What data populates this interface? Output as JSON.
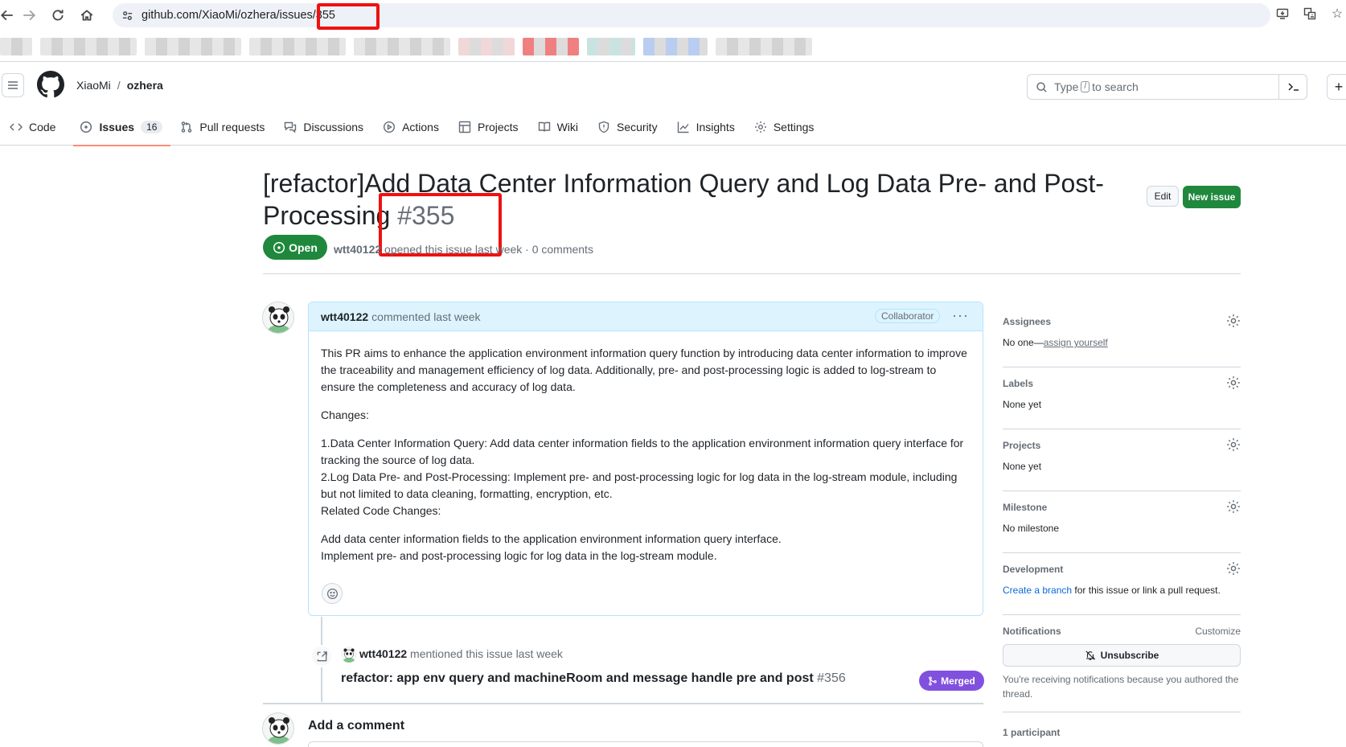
{
  "browser": {
    "url": "github.com/XiaoMi/ozhera/issues/355"
  },
  "header": {
    "owner": "XiaoMi",
    "separator": "/",
    "repo": "ozhera",
    "search_prefix": "Type",
    "search_key": "/",
    "search_suffix": "to search"
  },
  "repo_nav": {
    "tabs": [
      {
        "label": "Code",
        "icon": "code-icon"
      },
      {
        "label": "Issues",
        "icon": "issue-opened-icon",
        "count": "16",
        "selected": true
      },
      {
        "label": "Pull requests",
        "icon": "git-pull-request-icon"
      },
      {
        "label": "Discussions",
        "icon": "comment-discussion-icon"
      },
      {
        "label": "Actions",
        "icon": "play-icon"
      },
      {
        "label": "Projects",
        "icon": "table-icon"
      },
      {
        "label": "Wiki",
        "icon": "book-icon"
      },
      {
        "label": "Security",
        "icon": "shield-icon"
      },
      {
        "label": "Insights",
        "icon": "graph-icon"
      },
      {
        "label": "Settings",
        "icon": "gear-icon"
      }
    ]
  },
  "issue": {
    "title": "[refactor]Add Data Center Information Query and Log Data Pre- and Post-Processing",
    "number": "#355",
    "state": "Open",
    "author": "wtt40122",
    "meta_text": "opened this issue last week · 0 comments",
    "edit_label": "Edit",
    "new_issue_label": "New issue"
  },
  "comment": {
    "author": "wtt40122",
    "time_text": "commented last week",
    "badge": "Collaborator",
    "paragraphs": [
      "This PR aims to enhance the application environment information query function by introducing data center information to improve the traceability and management efficiency of log data. Additionally, pre- and post-processing logic is added to log-stream to ensure the completeness and accuracy of log data.",
      "Changes:",
      "1.Data Center Information Query: Add data center information fields to the application environment information query interface for tracking the source of log data.",
      "2.Log Data Pre- and Post-Processing: Implement pre- and post-processing logic for log data in the log-stream module, including but not limited to data cleaning, formatting, encryption, etc.",
      "Related Code Changes:",
      "Add data center information fields to the application environment information query interface.",
      "Implement pre- and post-processing logic for log data in the log-stream module."
    ]
  },
  "timeline": {
    "actor": "wtt40122",
    "event_text": "mentioned this issue last week",
    "pr_title": "refactor: app env query and machineRoom and message handle pre and post",
    "pr_number": "#356",
    "pr_state": "Merged"
  },
  "add_comment": {
    "title": "Add a comment"
  },
  "sidebar": {
    "assignees": {
      "heading": "Assignees",
      "value_prefix": "No one—",
      "link": "assign yourself"
    },
    "labels": {
      "heading": "Labels",
      "value": "None yet"
    },
    "projects": {
      "heading": "Projects",
      "value": "None yet"
    },
    "milestone": {
      "heading": "Milestone",
      "value": "No milestone"
    },
    "development": {
      "heading": "Development",
      "link": "Create a branch",
      "value_suffix": "for this issue or link a pull request."
    },
    "notifications": {
      "heading": "Notifications",
      "customize": "Customize",
      "button": "Unsubscribe",
      "text": "You're receiving notifications because you authored the thread."
    },
    "participants": "1 participant"
  },
  "colors": {
    "open": "#1f883d",
    "merged": "#8250df",
    "link": "#0969da",
    "tab_underline": "#fd8c73",
    "annotation_red": "#ee1111"
  }
}
